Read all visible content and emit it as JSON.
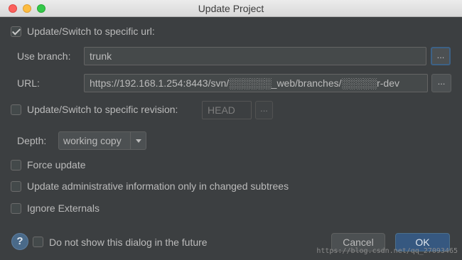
{
  "window": {
    "title": "Update Project"
  },
  "update_url": {
    "checked": true,
    "label": "Update/Switch to specific url:"
  },
  "branch": {
    "label": "Use branch:",
    "value": "trunk",
    "browse_label": "..."
  },
  "url": {
    "label": "URL:",
    "value": "https://192.168.1.254:8443/svn/░░░░░░_web/branches/░░░░░r-dev",
    "browse_label": "..."
  },
  "revision": {
    "checked": false,
    "label": "Update/Switch to specific revision:",
    "value": "HEAD",
    "browse_label": "..."
  },
  "depth": {
    "label": "Depth:",
    "value": "working copy"
  },
  "options": [
    {
      "checked": false,
      "label": "Force update"
    },
    {
      "checked": false,
      "label": "Update administrative information only in changed subtrees"
    },
    {
      "checked": false,
      "label": "Ignore Externals"
    }
  ],
  "footer": {
    "help_label": "?",
    "dont_show": {
      "checked": false,
      "label": "Do not show this dialog in the future"
    },
    "cancel_label": "Cancel",
    "ok_label": "OK"
  },
  "watermark": "https://blog.csdn.net/qq_27093465"
}
